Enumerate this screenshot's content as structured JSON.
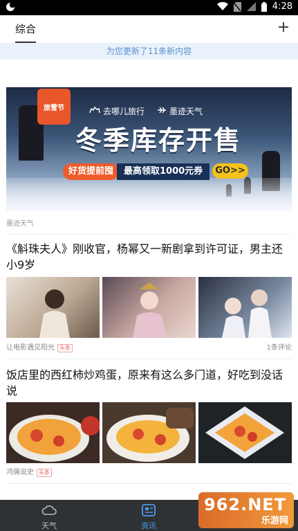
{
  "status_bar": {
    "time": "4:28"
  },
  "tabs": {
    "active": "综合",
    "add": "+"
  },
  "update_notice": "为您更新了11条新内容",
  "ad": {
    "sticker": "旅雪节",
    "brand_1": "去哪儿旅行",
    "brand_2": "墨迹天气",
    "headline": "冬季库存开售",
    "pill_1": "好货提前囤",
    "pill_2": "最高领取1000元券",
    "go": "GO>>",
    "source": "墨迹天气"
  },
  "articles": [
    {
      "title": "《斛珠夫人》刚收官，杨幂又一新剧拿到许可证，男主还小9岁",
      "source": "让电影遇见阳光",
      "tag": "头条",
      "comments": "1条评论"
    },
    {
      "title": "饭店里的西红柿炒鸡蛋，原来有这么多门道，好吃到没话说",
      "source": "鸿儒说史",
      "tag": "头条",
      "comments": ""
    }
  ],
  "bottom_nav": [
    {
      "label": "天气",
      "icon": "cloud-icon",
      "active": false
    },
    {
      "label": "资讯",
      "icon": "news-icon",
      "active": true
    }
  ],
  "watermark": {
    "big": "962.NET",
    "small": "乐游网"
  },
  "colors": {
    "accent": "#4a9af0",
    "update_bg": "#e9f2fb",
    "nav_bg": "#2f3234"
  }
}
